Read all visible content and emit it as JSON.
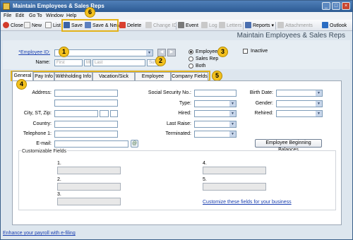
{
  "window": {
    "title": "Maintain Employees & Sales Reps"
  },
  "menu": [
    "File",
    "Edit",
    "Go To",
    "Window",
    "Help"
  ],
  "toolbar": {
    "close": "Close",
    "new": "New",
    "list": "List",
    "save": "Save",
    "save_new": "Save & New",
    "delete": "Delete",
    "change_id": "Change ID",
    "event": "Event",
    "log": "Log",
    "letters": "Letters",
    "reports": "Reports",
    "attachments": "Attachments",
    "outlook": "Outlook"
  },
  "form_title": "Maintain Employees & Sales Reps",
  "header": {
    "employee_id_label": "*Employee ID:",
    "name_label": "Name:",
    "name_placeholders": {
      "first": "First",
      "mi": "MI",
      "last": "Last",
      "suffix": "Suffix"
    },
    "type_options": [
      "Employee",
      "Sales Rep",
      "Both"
    ],
    "type_selected": "Employee",
    "inactive_label": "Inactive"
  },
  "tabs": [
    "General",
    "Pay Info",
    "Withholding Info",
    "Vacation/Sick Time",
    "Employee Fields",
    "Company Fields"
  ],
  "active_tab": "General",
  "general": {
    "address_label": "Address:",
    "city_label": "City, ST, Zip:",
    "country_label": "Country:",
    "telephone_label": "Telephone 1:",
    "email_label": "E-mail:",
    "ssn_label": "Social Security No.:",
    "type_label": "Type:",
    "hired_label": "Hired:",
    "last_raise_label": "Last Raise:",
    "terminated_label": "Terminated:",
    "birth_date_label": "Birth Date:",
    "gender_label": "Gender:",
    "rehired_label": "Rehired:",
    "ebb_button": "Employee Beginning Balances"
  },
  "custom": {
    "title": "Customizable Fields",
    "fields": [
      "1.",
      "2.",
      "3.",
      "4.",
      "5."
    ],
    "customize_link": "Customize these fields for your business"
  },
  "status_link": "Enhance your payroll with e-filing",
  "callouts": [
    "1",
    "2",
    "3",
    "4",
    "5",
    "6"
  ],
  "colors": {
    "accent": "#f2c01e",
    "callout_border": "#e2b21a",
    "titlebar": "#2c5a93",
    "link": "#1a3fb0"
  }
}
